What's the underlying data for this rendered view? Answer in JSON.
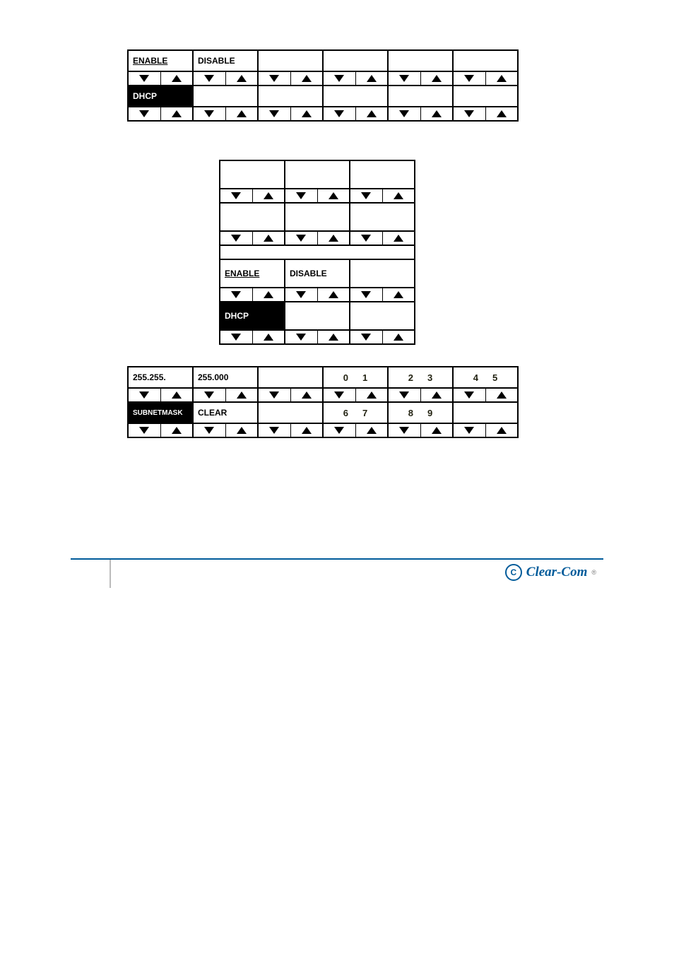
{
  "panel1": {
    "row0": [
      "ENABLE",
      "DISABLE",
      "",
      "",
      "",
      ""
    ],
    "row1": [
      "DHCP",
      "",
      "",
      "",
      "",
      ""
    ],
    "row0_underline": [
      true,
      false,
      false,
      false,
      false,
      false
    ],
    "row1_invert": [
      true,
      false,
      false,
      false,
      false,
      false
    ]
  },
  "panel2": {
    "row0": [
      "",
      "",
      ""
    ],
    "row1": [
      "",
      "",
      ""
    ],
    "row2_wide": "",
    "row3": [
      "ENABLE",
      "DISABLE",
      ""
    ],
    "row3_underline": [
      true,
      false,
      false
    ],
    "row4": [
      "DHCP",
      "",
      ""
    ],
    "row4_invert": [
      true,
      false,
      false
    ]
  },
  "body": {
    "after_panel1": "",
    "panel2_caption": "",
    "para_enable_1": "",
    "para_enable_2": "",
    "heading_subnet": "",
    "para_subnet_1": "",
    "para_subnet_2": ""
  },
  "panel3": {
    "row0": [
      "255.255.",
      "255.000",
      ""
    ],
    "row0_digits": [
      "",
      "",
      "",
      "0 1",
      "2 3",
      "4 5"
    ],
    "row1": [
      "SUBNETMASK",
      "CLEAR",
      ""
    ],
    "row1_invert": [
      true,
      false,
      false
    ],
    "row1_digits": [
      "",
      "",
      "",
      "6 7",
      "8 9",
      ""
    ]
  },
  "footer": {
    "page": "",
    "brand": "Clear-Com"
  }
}
